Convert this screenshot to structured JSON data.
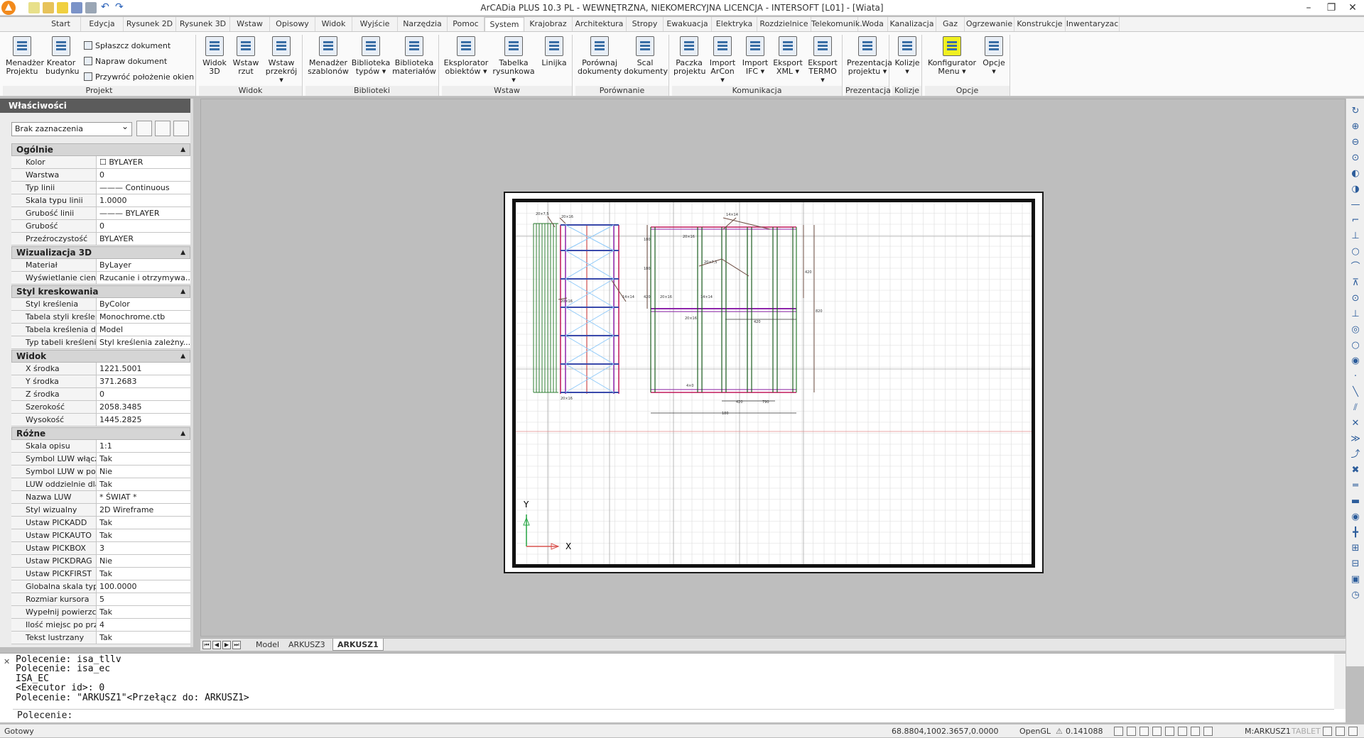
{
  "titlebar": {
    "title": "ArCADia PLUS 10.3 PL - WEWNĘTRZNA, NIEKOMERCYJNA LICENCJA - INTERSOFT [L01] - [Wiata]",
    "minimize": "–",
    "restore": "❐",
    "close": "✕"
  },
  "tabs": [
    "Start",
    "Edycja",
    "Rysunek 2D",
    "Rysunek 3D",
    "Wstaw",
    "Opisowy",
    "Widok",
    "Wyjście",
    "Narzędzia",
    "Pomoc",
    "System",
    "Krajobraz",
    "Architektura",
    "Stropy",
    "Ewakuacja",
    "Elektryka",
    "Rozdzielnice",
    "Telekomunik.",
    "Woda",
    "Kanalizacja",
    "Gaz",
    "Ogrzewanie",
    "Konstrukcje",
    "Inwentaryzac"
  ],
  "active_tab": "System",
  "ribbon": {
    "projekt": {
      "label": "Projekt",
      "buttons": [
        "Menadżer Projektu",
        "Kreator budynku"
      ],
      "small": [
        "Spłaszcz dokument",
        "Napraw dokument",
        "Przywróć położenie okien"
      ]
    },
    "widok": {
      "label": "Widok",
      "buttons": [
        "Widok 3D",
        "Wstaw rzut",
        "Wstaw przekrój ▾"
      ]
    },
    "biblioteki": {
      "label": "Biblioteki",
      "buttons": [
        "Menadżer szablonów",
        "Biblioteka typów ▾",
        "Biblioteka materiałów"
      ]
    },
    "wstaw": {
      "label": "Wstaw",
      "buttons": [
        "Eksplorator obiektów ▾",
        "Tabelka rysunkowa ▾",
        "Linijka"
      ]
    },
    "porownanie": {
      "label": "Porównanie",
      "buttons": [
        "Porównaj dokumenty",
        "Scal dokumenty"
      ]
    },
    "komunikacja": {
      "label": "Komunikacja",
      "buttons": [
        "Paczka projektu",
        "Import ArCon ▾",
        "Import IFC ▾",
        "Eksport XML ▾",
        "Eksport TERMO ▾"
      ]
    },
    "prezentacja": {
      "label": "Prezentacja",
      "buttons": [
        "Prezentacja projektu ▾"
      ]
    },
    "kolizje": {
      "label": "Kolizje",
      "buttons": [
        "Kolizje ▾"
      ]
    },
    "opcje": {
      "label": "Opcje",
      "buttons": [
        "Konfigurator Menu ▾",
        "Opcje ▾"
      ]
    }
  },
  "props": {
    "title": "Właściwości",
    "selection": "Brak zaznaczenia",
    "sections": [
      {
        "name": "Ogólnie",
        "rows": [
          [
            "Kolor",
            "☐ BYLAYER"
          ],
          [
            "Warstwa",
            "0"
          ],
          [
            "Typ linii",
            "——— Continuous"
          ],
          [
            "Skala typu linii",
            "1.0000"
          ],
          [
            "Grubość linii",
            "——— BYLAYER"
          ],
          [
            "Grubość",
            "0"
          ],
          [
            "Przeźroczystość",
            "BYLAYER"
          ]
        ]
      },
      {
        "name": "Wizualizacja 3D",
        "rows": [
          [
            "Materiał",
            "ByLayer"
          ],
          [
            "Wyświetlanie cieni",
            "Rzucanie i otrzymywa..."
          ]
        ]
      },
      {
        "name": "Styl kreskowania",
        "rows": [
          [
            "Styl kreślenia",
            "ByColor"
          ],
          [
            "Tabela styli kreślenia",
            "Monochrome.ctb"
          ],
          [
            "Tabela kreślenia doł...",
            "Model"
          ],
          [
            "Typ tabeli kreślenia",
            "Styl kreślenia zależny..."
          ]
        ]
      },
      {
        "name": "Widok",
        "rows": [
          [
            "X środka",
            "1221.5001"
          ],
          [
            "Y środka",
            "371.2683"
          ],
          [
            "Z środka",
            "0"
          ],
          [
            "Szerokość",
            "2058.3485"
          ],
          [
            "Wysokość",
            "1445.2825"
          ]
        ]
      },
      {
        "name": "Różne",
        "rows": [
          [
            "Skala opisu",
            "1:1"
          ],
          [
            "Symbol LUW włączo...",
            "Tak"
          ],
          [
            "Symbol LUW w pocz...",
            "Nie"
          ],
          [
            "LUW oddzielnie dla k...",
            "Tak"
          ],
          [
            "Nazwa LUW",
            "* ŚWIAT *"
          ],
          [
            "Styl wizualny",
            "2D Wireframe"
          ],
          [
            "Ustaw PICKADD",
            "Tak"
          ],
          [
            "Ustaw PICKAUTO",
            "Tak"
          ],
          [
            "Ustaw PICKBOX",
            "3"
          ],
          [
            "Ustaw PICKDRAG",
            "Nie"
          ],
          [
            "Ustaw PICKFIRST",
            "Tak"
          ],
          [
            "Globalna skala typu linii",
            "100.0000"
          ],
          [
            "Rozmiar kursora",
            "5"
          ],
          [
            "Wypełnij powierzchnię",
            "Tak"
          ],
          [
            "Ilość miejsc po przeci...",
            "4"
          ],
          [
            "Tekst lustrzany",
            "Tak"
          ]
        ]
      }
    ]
  },
  "layout_tabs": [
    "Model",
    "ARKUSZ3",
    "ARKUSZ1"
  ],
  "active_layout": "ARKUSZ1",
  "axes": {
    "x": "X",
    "y": "Y"
  },
  "drawing_labels": [
    "20×7,5",
    "20×16",
    "14×14",
    "20×16",
    "20×7,5",
    "14×14",
    "20×16",
    "14×14",
    "20×16",
    "20×16",
    "20×16",
    "4×0",
    "420",
    "420",
    "790",
    "180",
    "180",
    "180",
    "420",
    "420",
    "820"
  ],
  "command": {
    "history": [
      "Polecenie: isa_tllv",
      "Polecenie: isa_ec",
      "ISA_EC",
      "<Executor id>: 0",
      "Polecenie: \"ARKUSZ1\"<Przełącz do: ARKUSZ1>"
    ],
    "prompt": "Polecenie:"
  },
  "status": {
    "left": "Gotowy",
    "coords": "68.8804,1002.3657,0.0000",
    "renderer": "OpenGL",
    "scale": "0.141088",
    "layout": "M:ARKUSZ1",
    "tablet": "TABLET"
  },
  "colors": {
    "accent": "#f28a1c",
    "panel_header": "#5b5b5b"
  }
}
